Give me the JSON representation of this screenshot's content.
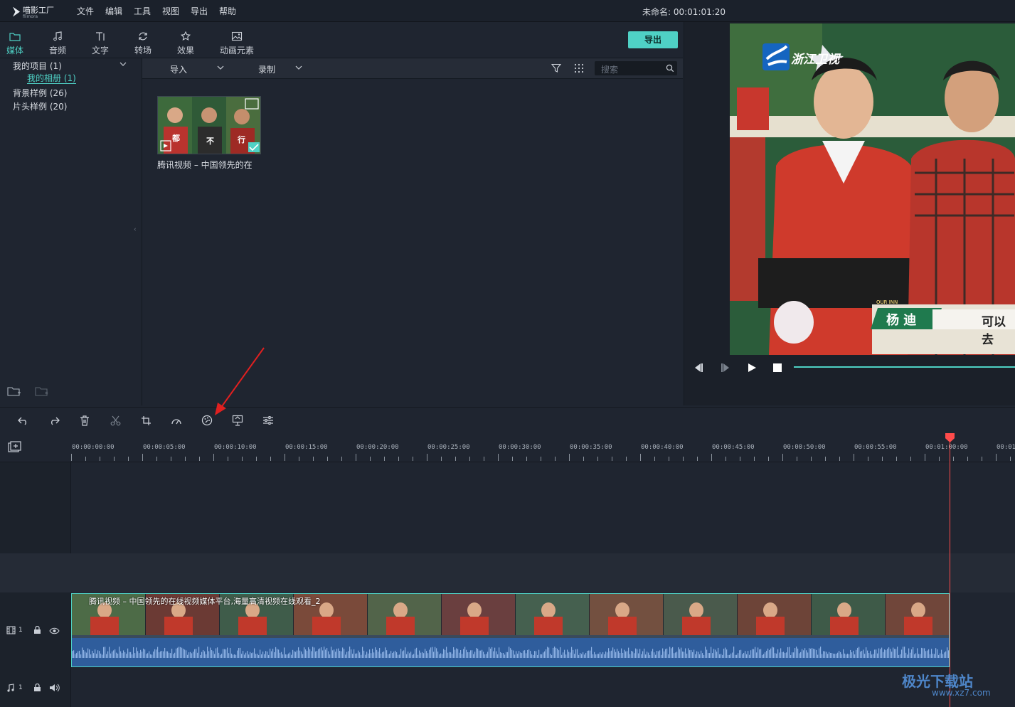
{
  "app": {
    "logo_text": "喵影工厂",
    "logo_sub": "filmora",
    "menu": [
      "文件",
      "编辑",
      "工具",
      "视图",
      "导出",
      "帮助"
    ],
    "project_name": "未命名: 00:01:01:20"
  },
  "media_tabs": [
    {
      "label": "媒体",
      "icon": "folder-icon",
      "active": true
    },
    {
      "label": "音频",
      "icon": "music-note-icon",
      "active": false
    },
    {
      "label": "文字",
      "icon": "text-icon",
      "active": false
    },
    {
      "label": "转场",
      "icon": "transition-icon",
      "active": false
    },
    {
      "label": "效果",
      "icon": "effects-icon",
      "active": false
    },
    {
      "label": "动画元素",
      "icon": "image-icon",
      "active": false
    }
  ],
  "export_label": "导出",
  "tree": {
    "my_project": "我的项目 (1)",
    "my_album": "我的相册 (1)",
    "background_samples": "背景样例 (26)",
    "intro_samples": "片头样例 (20)"
  },
  "media_toolbar": {
    "import_label": "导入",
    "record_label": "录制",
    "search_placeholder": "搜索"
  },
  "media_item": {
    "label": "腾讯视频 – 中国领先的在",
    "frame_captions": [
      "都",
      "不",
      "行"
    ]
  },
  "preview": {
    "channel_logo": "浙江卫视",
    "lower_third_name": "杨 迪",
    "lower_third_tag": "OUR INN",
    "subtitle_fragment": "可以去"
  },
  "timeline": {
    "timecodes": [
      "00:00:00:00",
      "00:00:05:00",
      "00:00:10:00",
      "00:00:15:00",
      "00:00:20:00",
      "00:00:25:00",
      "00:00:30:00",
      "00:00:35:00",
      "00:00:40:00",
      "00:00:45:00",
      "00:00:50:00",
      "00:00:55:00",
      "00:01:00:00",
      "00:01"
    ],
    "clip_title": "腾讯视频 – 中国领先的在线视频媒体平台,海量高清视频在线观看_2",
    "video_track_label": "1",
    "audio_track_label": "1"
  },
  "watermark": {
    "main": "极光下载站",
    "url": "www.xz7.com"
  },
  "colors": {
    "accent": "#4fd1c5",
    "playhead": "#ff4b4b",
    "background": "#1f2530",
    "audio_wave": "#2f5d9c"
  }
}
